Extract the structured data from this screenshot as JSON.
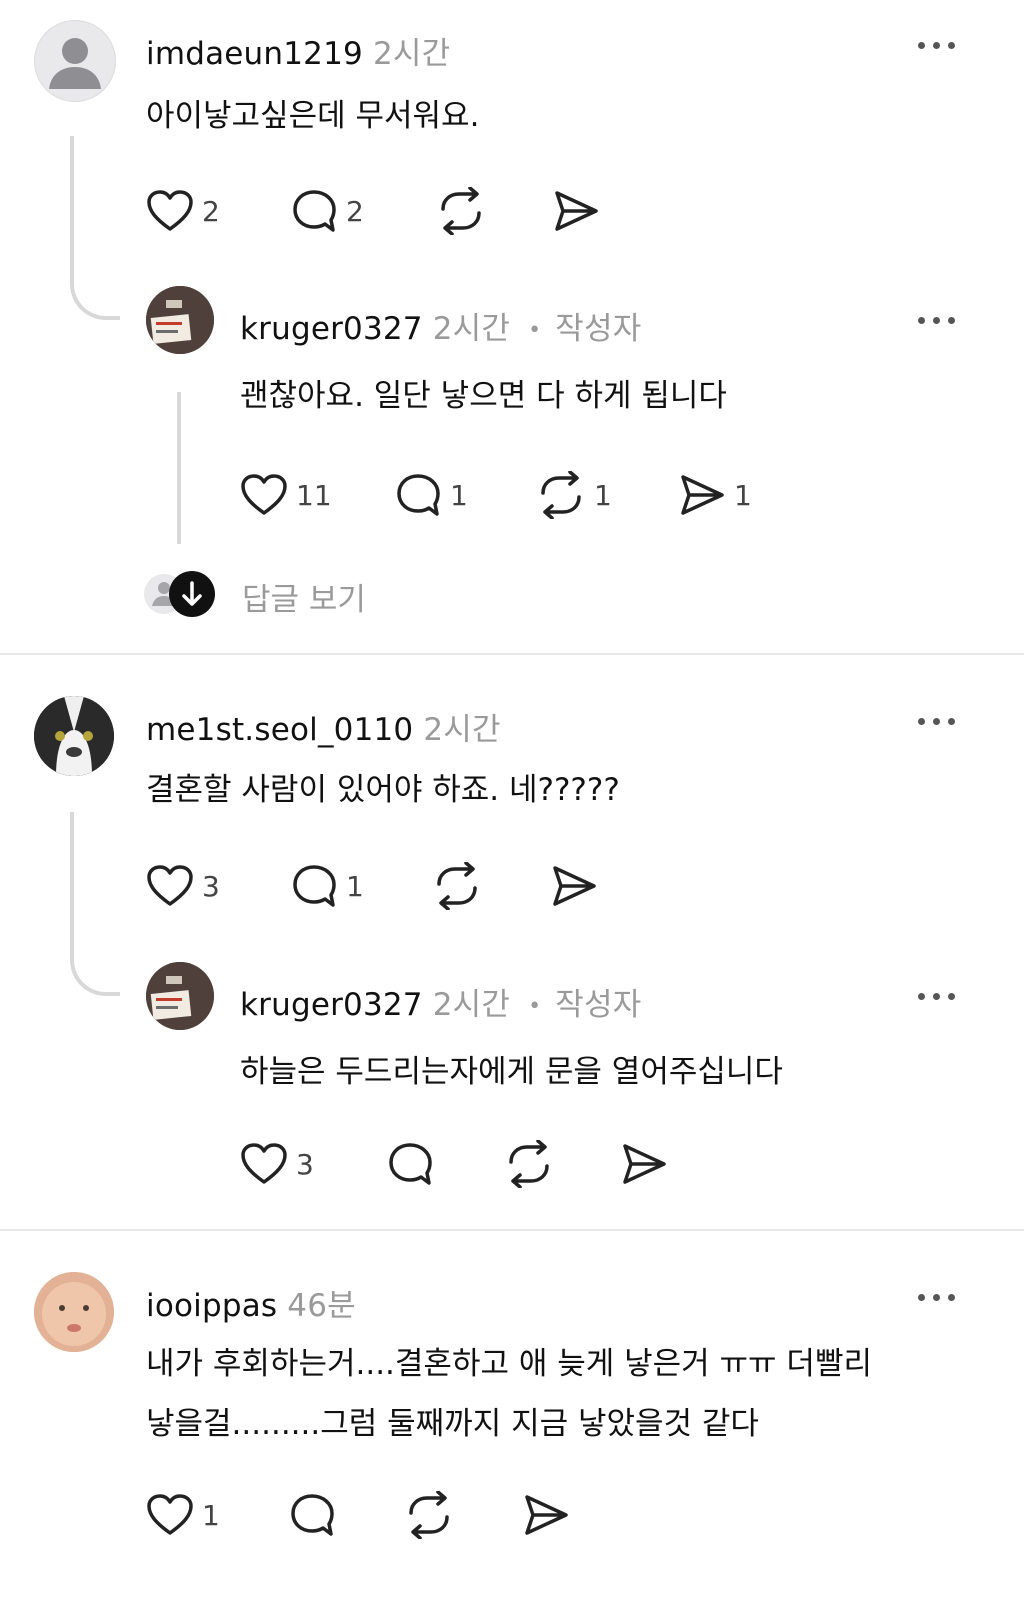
{
  "threads": [
    {
      "comment": {
        "username": "imdaeun1219",
        "time": "2시간",
        "text": "아이낳고싶은데 무서워요.",
        "likes": "2",
        "replies": "2",
        "reposts": "",
        "shares": ""
      },
      "reply": {
        "username": "kruger0327",
        "time": "2시간",
        "author_badge": "작성자",
        "text": "괜찮아요. 일단 낳으면 다 하게 됩니다",
        "likes": "11",
        "replies": "1",
        "reposts": "1",
        "shares": "1"
      },
      "view_replies_label": "답글 보기"
    },
    {
      "comment": {
        "username": "me1st.seol_0110",
        "time": "2시간",
        "text": "결혼할 사람이 있어야 하죠. 네?????",
        "likes": "3",
        "replies": "1",
        "reposts": "",
        "shares": ""
      },
      "reply": {
        "username": "kruger0327",
        "time": "2시간",
        "author_badge": "작성자",
        "text": "하늘은 두드리는자에게 문을 열어주십니다",
        "likes": "3",
        "replies": "",
        "reposts": "",
        "shares": ""
      }
    },
    {
      "comment": {
        "username": "iooippas",
        "time": "46분",
        "text_line1": "내가 후회하는거....결혼하고 애 늦게 낳은거 ㅠㅠ 더빨리",
        "text_line2": "낳을걸.........그럼 둘째까지 지금 낳았을것 같다",
        "likes": "1",
        "replies": "",
        "reposts": "",
        "shares": ""
      }
    }
  ],
  "icons": [
    "more-icon",
    "heart-icon",
    "comment-icon",
    "repost-icon",
    "share-icon",
    "arrow-down-icon"
  ],
  "colors": {
    "text": "#111111",
    "muted": "#9a9a9a",
    "line": "#d8d8d8",
    "divider": "#e6e6e6"
  }
}
